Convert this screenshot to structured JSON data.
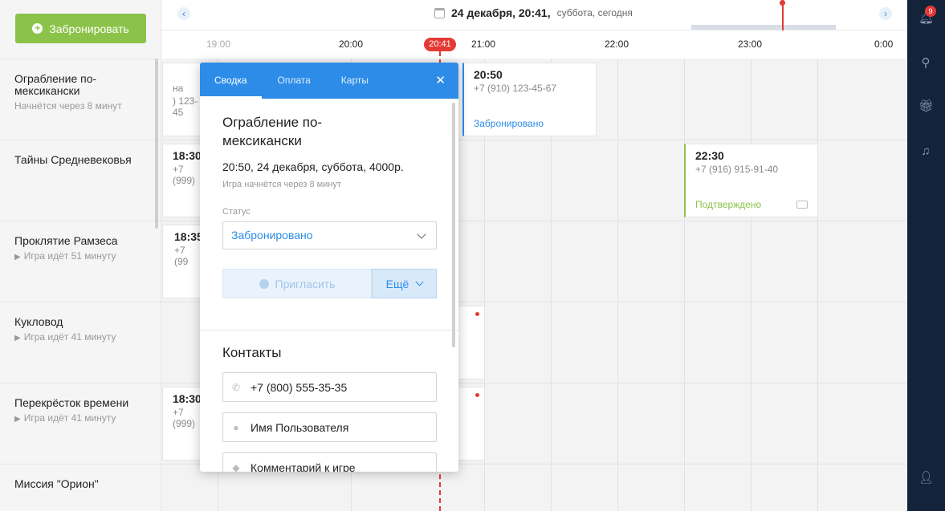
{
  "toolbar": {
    "book_label": "Забронировать"
  },
  "header": {
    "date": "24 декабря, 20:41,",
    "date_rest": "суббота, сегодня",
    "times": [
      "19:00",
      "20:00",
      "21:00",
      "22:00",
      "23:00",
      "0:00"
    ],
    "now": "20:41"
  },
  "rooms": [
    {
      "name": "Ограбление по-мексикански",
      "sub": "Начнётся через 8 минут"
    },
    {
      "name": "Тайны Средневековья",
      "sub": ""
    },
    {
      "name": "Проклятие Рамзеса",
      "sub": "Игра идёт 51 минуту"
    },
    {
      "name": "Кукловод",
      "sub": "Игра идёт 41 минуту"
    },
    {
      "name": "Перекрёсток времени",
      "sub": "Игра идёт 41 минуту"
    },
    {
      "name": "Миссия \"Орион\"",
      "sub": ""
    }
  ],
  "cards": {
    "c1": {
      "time": "",
      "phone_part": "на",
      "phone": ") 123-45"
    },
    "c2": {
      "time": "18:30",
      "phone": "+7 (999)"
    },
    "c3": {
      "time": "18:35",
      "phone": "+7 (99"
    },
    "c5": {
      "time": "18:30",
      "phone": "+7 (999)"
    },
    "c_2050": {
      "time": "20:50",
      "phone": "+7 (910) 123-45-67",
      "status": "Забронировано"
    },
    "c_2230": {
      "time": "22:30",
      "phone": "+7 (916) 915-91-40",
      "status": "Подтверждено"
    }
  },
  "colors": {
    "accent": "#2d8ce8",
    "green": "#8bc34a",
    "now": "#e53935",
    "sidebar": "#13233a"
  },
  "sidebar": {
    "notifications": "9"
  },
  "popup": {
    "tabs": [
      "Сводка",
      "Оплата",
      "Карты"
    ],
    "title": "Ограбление по-мексикански",
    "info": "20:50, 24 декабря, суббота, 4000р.",
    "note": "Игра начнётся через 8 минут",
    "status_label": "Статус",
    "status_value": "Забронировано",
    "invite_label": "Пригласить",
    "more_label": "Ещё",
    "contacts_title": "Контакты",
    "phone": "+7 (800) 555-35-35",
    "user": "Имя Пользователя",
    "comment": "Комментарий к игре"
  }
}
